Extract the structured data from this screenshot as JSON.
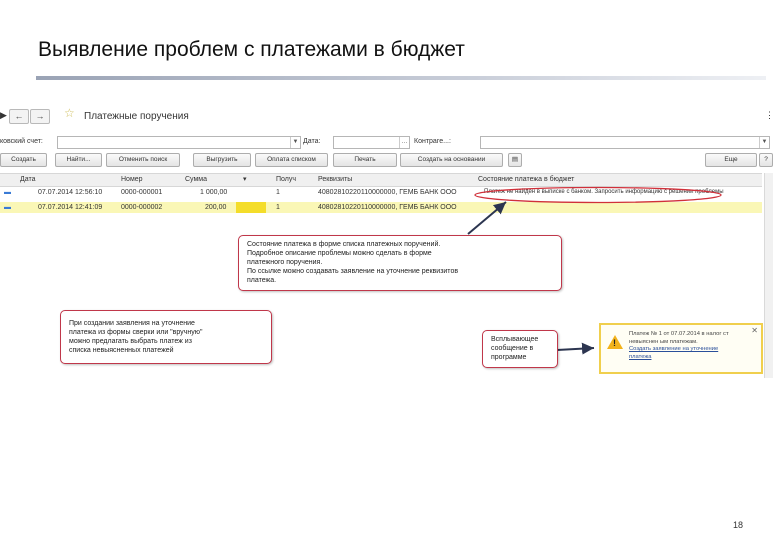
{
  "slide": {
    "title": "Выявление проблем с платежами в бюджет",
    "page_number": "18"
  },
  "window": {
    "title": "Платежные поручения",
    "back_icon": "arrow-left-icon",
    "forward_icon": "arrow-right-icon",
    "favorite_icon": "star-icon",
    "menu_icon": "more-vertical-icon"
  },
  "filters": {
    "account_label": "ковский счет:",
    "date_label": "Дата:",
    "counterparty_label": "Контраге...:",
    "account_value": "",
    "date_value": "",
    "counterparty_value": ""
  },
  "toolbar": {
    "create": "Создать",
    "find": "Найти...",
    "cancel_search": "Отменить поиск",
    "upload": "Выгрузить",
    "pay_list": "Оплата списком",
    "print": "Печать",
    "create_based": "Создать на основании",
    "more": "Еще",
    "help": "?"
  },
  "columns": [
    "Дата",
    "Номер",
    "Сумма",
    "",
    "Получ",
    "Реквизиты",
    "Состояние платежа в бюджет"
  ],
  "rows": [
    {
      "date": "07.07.2014 12:56:10",
      "number": "0000-000001",
      "amount": "1 000,00",
      "recipient": "1",
      "details": "40802810220110000000, ГЕМБ БАНК ООО",
      "status": "Платеж не найден в выписке с банком. Запросить информацию с решении проблемы"
    },
    {
      "date": "07.07.2014 12:41:09",
      "number": "0000-000002",
      "amount": "200,00",
      "recipient": "1",
      "details": "40802810220110000000, ГЕМБ БАНК ООО",
      "status": ""
    }
  ],
  "callouts": {
    "status_note": [
      "Состояние платежа в форме списка платежных поручений.",
      "Подробное описание проблемы можно сделать в форме",
      "платежного поручения.",
      "По ссылке можно создавать заявление на уточнение реквизитов",
      "платежа."
    ],
    "statement_note": [
      "При создании заявления на уточнение",
      "платежа из формы сверки или \"вручную\"",
      "можно предлагать выбрать платеж из",
      "списка невыясненных платежей"
    ],
    "popup_note": [
      "Всплывающее",
      "сообщение в",
      "программе"
    ]
  },
  "popup": {
    "line1": "Платеж № 1 от 07.07.2014 в налог ст",
    "line2": "невыяснен ым платежам.",
    "link1": "Создать заявление на уточнение",
    "link2": "платежа"
  },
  "colors": {
    "callout_border": "#c0374a",
    "selected_row": "#faf7b6",
    "popup_border": "#f0cf4d",
    "warning": "#f2b21a"
  }
}
